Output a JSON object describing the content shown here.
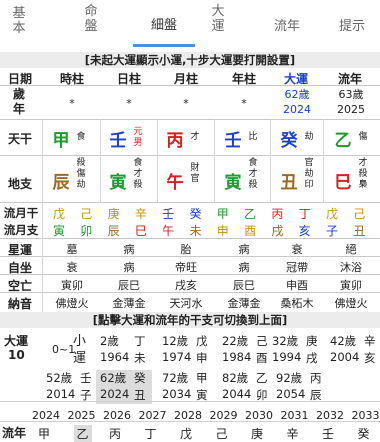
{
  "tabs": [
    {
      "label": "基\n本",
      "name": "tab-basic"
    },
    {
      "label": "命\n盤",
      "name": "tab-chart"
    },
    {
      "label": "細盤",
      "name": "tab-detail"
    },
    {
      "label": "大\n運",
      "name": "tab-luck"
    },
    {
      "label": "流年",
      "name": "tab-annual"
    },
    {
      "label": "提示",
      "name": "tab-tips"
    }
  ],
  "active_tab": "細盤",
  "banner_top": "[未起大運顯示小運,十步大運要打開設置]",
  "banner_mid": "[點擊大運和流年的干支可切換到上面]",
  "headers": {
    "label": "日期",
    "cols": [
      "時柱",
      "日柱",
      "月柱",
      "年柱",
      "大運",
      "流年"
    ]
  },
  "age_row": {
    "label": "歲\n年",
    "cols": [
      "*",
      "*",
      "*",
      "*",
      "62歲\n2024",
      "63歲\n2025"
    ]
  },
  "stem_row": {
    "label": "天干",
    "cols": [
      {
        "char": "甲",
        "side": "食",
        "color": "#1c9a2b"
      },
      {
        "char": "壬",
        "side": "元\n男",
        "color": "#1b41c9"
      },
      {
        "char": "丙",
        "side": "才",
        "color": "#d42020"
      },
      {
        "char": "壬",
        "side": "比",
        "color": "#1b41c9"
      },
      {
        "char": "癸",
        "side": "劫",
        "color": "#1b41c9"
      },
      {
        "char": "乙",
        "side": "傷",
        "color": "#1c9a2b"
      }
    ]
  },
  "branch_row": {
    "label": "地支",
    "cols": [
      {
        "char": "辰",
        "side": "殺\n傷\n劫",
        "color": "#9a6b1c"
      },
      {
        "char": "寅",
        "side": "食\n才\n殺",
        "color": "#1c9a2b"
      },
      {
        "char": "午",
        "side": "財\n官",
        "color": "#d42020"
      },
      {
        "char": "寅",
        "side": "食\n才\n殺",
        "color": "#1c9a2b"
      },
      {
        "char": "丑",
        "side": "官\n劫\n印",
        "color": "#9a6b1c"
      },
      {
        "char": "巳",
        "side": "才\n殺\n梟",
        "color": "#d42020"
      }
    ]
  },
  "flow_month_stem": {
    "label": "流月干",
    "chars": [
      "戊",
      "己",
      "庚",
      "辛",
      "壬",
      "癸",
      "甲",
      "乙",
      "丙",
      "丁",
      "戊",
      "己"
    ]
  },
  "flow_month_branch": {
    "label": "流月支",
    "chars": [
      "寅",
      "卯",
      "辰",
      "巳",
      "午",
      "未",
      "申",
      "酉",
      "戌",
      "亥",
      "子",
      "丑"
    ]
  },
  "star_row": {
    "label": "星運",
    "cols": [
      "墓",
      "病",
      "胎",
      "病",
      "衰",
      "絕"
    ]
  },
  "self_row": {
    "label": "自坐",
    "cols": [
      "衰",
      "病",
      "帝旺",
      "病",
      "冠帶",
      "沐浴"
    ]
  },
  "void_row": {
    "label": "空亡",
    "cols": [
      "寅卯",
      "辰巳",
      "戌亥",
      "辰巳",
      "申酉",
      "寅卯"
    ]
  },
  "nayin_row": {
    "label": "納音",
    "cols": [
      "佛燈火",
      "金薄金",
      "天河水",
      "金薄金",
      "桑柘木",
      "佛燈火"
    ]
  },
  "luck": {
    "label": "大運",
    "age": "10",
    "xiaoyun": "0~1",
    "xiaoyun_label": "小\n運",
    "periods": [
      {
        "age": "2歲",
        "stem": "丁",
        "year": "1964",
        "branch": "未"
      },
      {
        "age": "12歲",
        "stem": "戊",
        "year": "1974",
        "branch": "申"
      },
      {
        "age": "22歲",
        "stem": "己",
        "year": "1984",
        "branch": "酉"
      },
      {
        "age": "32歲",
        "stem": "庚",
        "year": "1994",
        "branch": "戌"
      },
      {
        "age": "42歲",
        "stem": "辛",
        "year": "2004",
        "branch": "亥"
      },
      {
        "age": "52歲",
        "stem": "壬",
        "year": "2014",
        "branch": "子"
      },
      {
        "age": "62歲",
        "stem": "癸",
        "year": "2024",
        "branch": "丑"
      },
      {
        "age": "72歲",
        "stem": "甲",
        "year": "2034",
        "branch": "寅"
      },
      {
        "age": "82歲",
        "stem": "乙",
        "year": "2044",
        "branch": "卯"
      },
      {
        "age": "92歲",
        "stem": "丙",
        "year": "2054",
        "branch": "辰"
      }
    ]
  },
  "years": [
    "2024",
    "2025",
    "2026",
    "2027",
    "2028",
    "2029",
    "2030",
    "2031",
    "2032",
    "2033"
  ],
  "flow_year": {
    "label": "流年",
    "chars": [
      "甲",
      "乙",
      "丙",
      "丁",
      "戊",
      "己",
      "庚",
      "辛",
      "壬",
      "癸"
    ]
  }
}
